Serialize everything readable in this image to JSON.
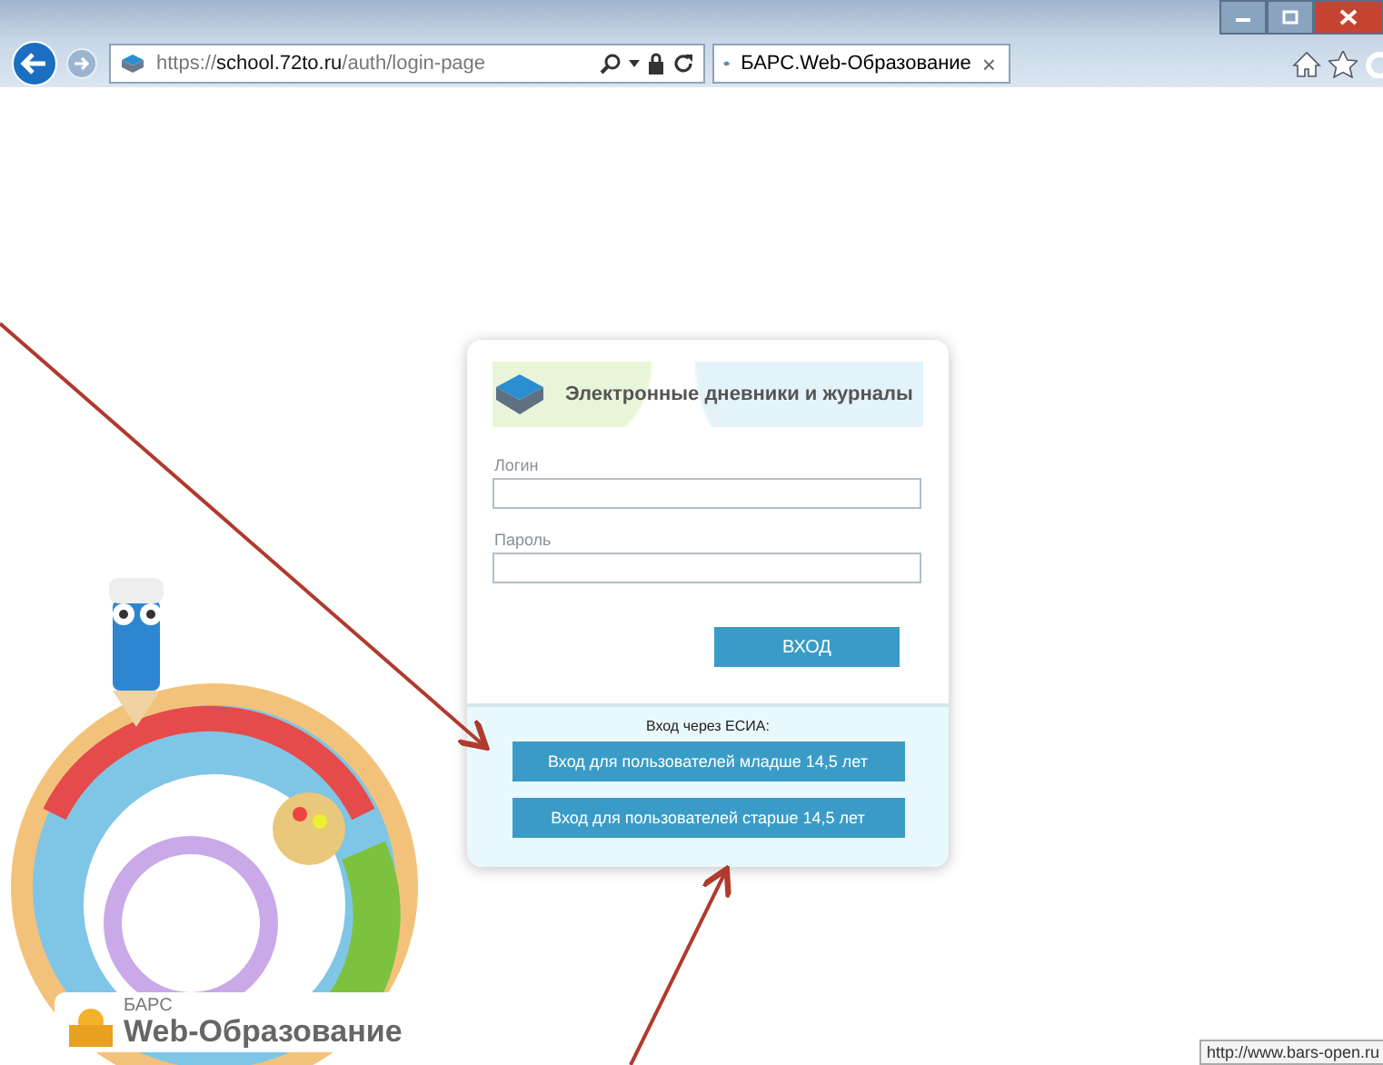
{
  "browser": {
    "address": {
      "scheme": "https://",
      "host": "school.72to.ru",
      "path": "/auth/login-page"
    },
    "tab": {
      "title": "БАРС.Web-Образование",
      "close": "×"
    }
  },
  "login_card": {
    "heading": "Электронные дневники и журналы",
    "fields": [
      {
        "label": "Логин"
      },
      {
        "label": "Пароль"
      }
    ],
    "submit": "ВХОД",
    "esia": {
      "caption": "Вход через ЕСИА:",
      "buttons": [
        "Вход для пользователей младше 14,5 лет",
        "Вход для пользователей старше 14,5 лет"
      ]
    }
  },
  "logo": {
    "brand": "БАРС",
    "product": "Web-Образование"
  },
  "status_url": "http://www.bars-open.ru"
}
